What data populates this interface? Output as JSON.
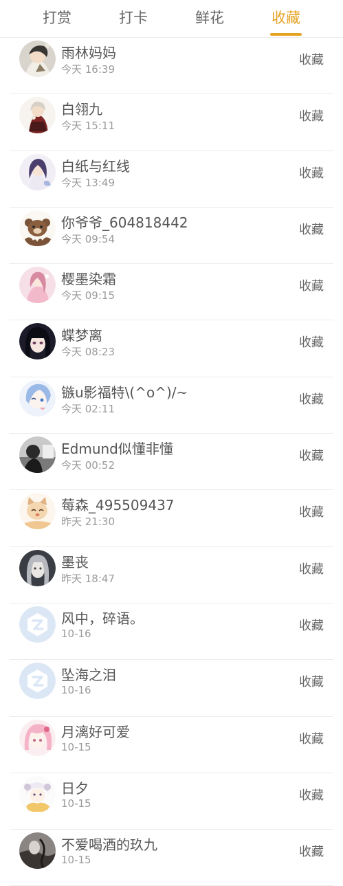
{
  "tabs": [
    {
      "label": "打赏",
      "active": false
    },
    {
      "label": "打卡",
      "active": false
    },
    {
      "label": "鲜花",
      "active": false
    },
    {
      "label": "收藏",
      "active": true
    }
  ],
  "accent_color": "#e6a323",
  "action_label": "收藏",
  "items": [
    {
      "name": "雨林妈妈",
      "time": "今天 16:39",
      "avatar": "anime-avatar-dark-haired-character"
    },
    {
      "name": "白翎九",
      "time": "今天 15:11",
      "avatar": "anime-avatar-red-dress-character"
    },
    {
      "name": "白纸与红线",
      "time": "今天 13:49",
      "avatar": "anime-avatar-purple-haired-girl"
    },
    {
      "name": "你爷爷_604818442",
      "time": "今天 09:54",
      "avatar": "bear-cartoon-avatar"
    },
    {
      "name": "樱墨染霜",
      "time": "今天 09:15",
      "avatar": "anime-avatar-pink-girl"
    },
    {
      "name": "蝶梦离",
      "time": "今天 08:23",
      "avatar": "anime-avatar-black-haired-girl"
    },
    {
      "name": "镞u影福特\\(^o^)/~",
      "time": "今天 02:11",
      "avatar": "anime-avatar-blue-haired-character"
    },
    {
      "name": "Edmund似懂非懂",
      "time": "今天 00:52",
      "avatar": "grayscale-photo-avatar"
    },
    {
      "name": "莓森_495509437",
      "time": "昨天 21:30",
      "avatar": "cartoon-cat-avatar"
    },
    {
      "name": "墨丧",
      "time": "昨天 18:47",
      "avatar": "anime-avatar-gray-haired-girl"
    },
    {
      "name": "风中，碎语。",
      "time": "10-16",
      "avatar": "default-avatar"
    },
    {
      "name": "坠海之泪",
      "time": "10-16",
      "avatar": "default-avatar"
    },
    {
      "name": "月漓好可爱",
      "time": "10-15",
      "avatar": "anime-avatar-pink-haired-girl"
    },
    {
      "name": "日夕",
      "time": "10-15",
      "avatar": "chibi-sheep-girl-avatar"
    },
    {
      "name": "不爱喝酒的玖九",
      "time": "10-15",
      "avatar": "dark-ink-art-avatar"
    }
  ]
}
